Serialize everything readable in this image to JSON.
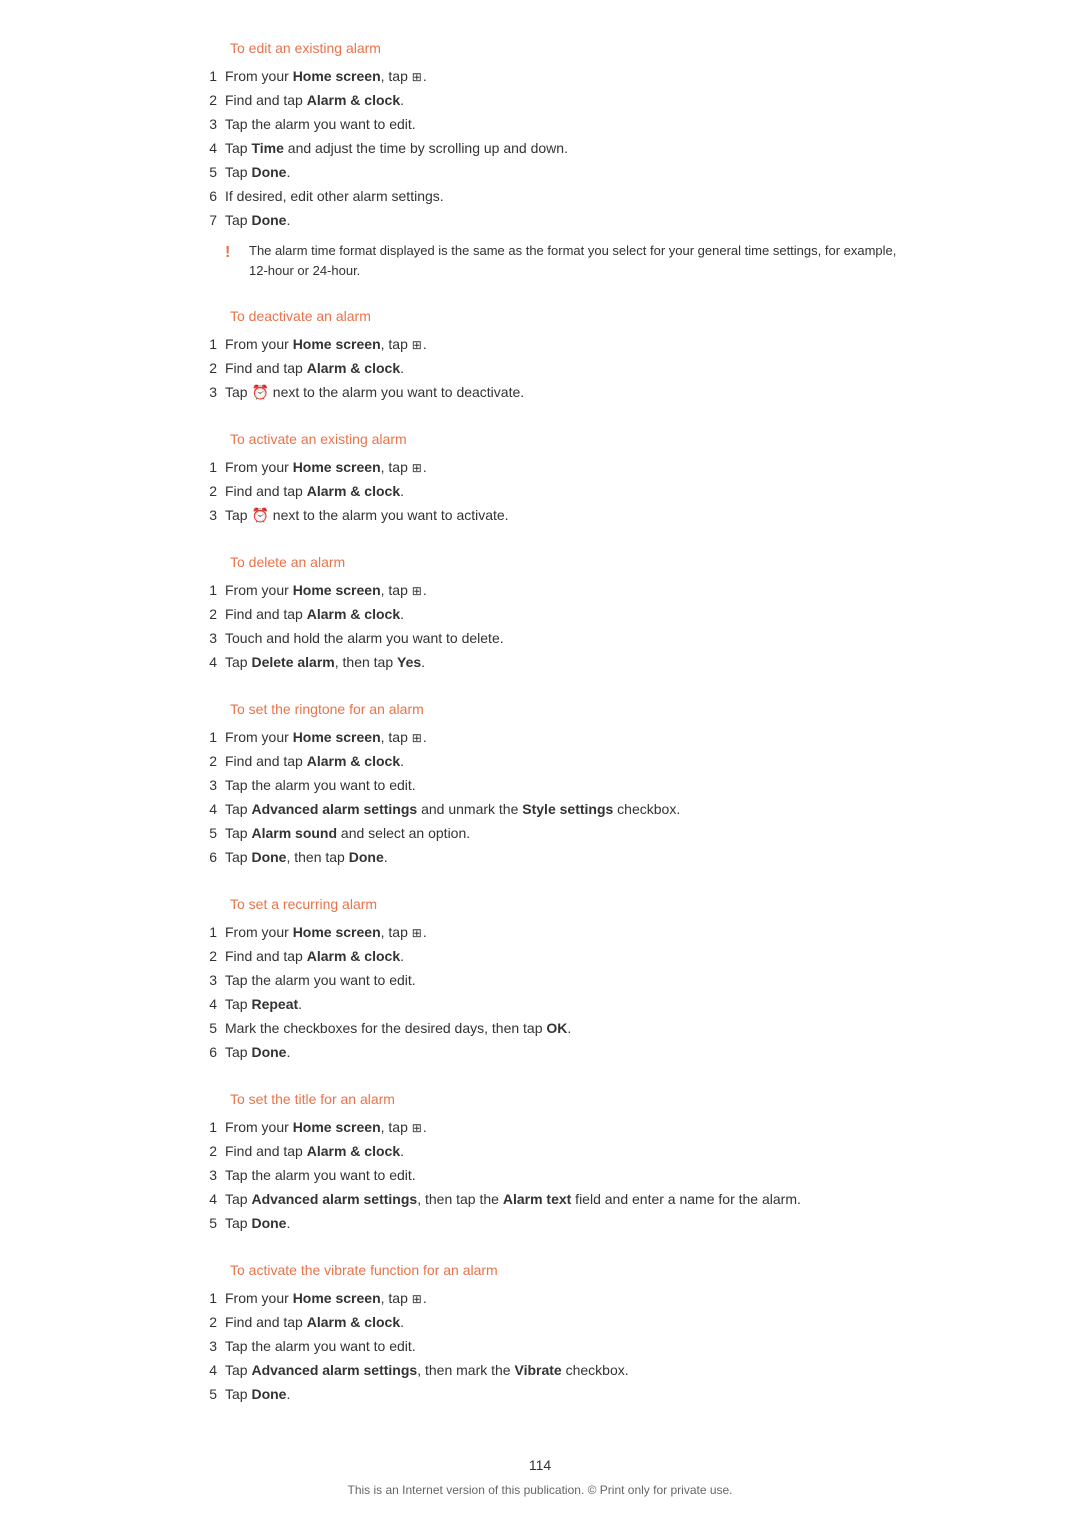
{
  "sections": [
    {
      "id": "edit-alarm",
      "title": "To edit an existing alarm",
      "steps": [
        {
          "num": "1",
          "text": "From your <b>Home screen</b>, tap <span class=\"menu-icon\">⊞</span>."
        },
        {
          "num": "2",
          "text": "Find and tap <b>Alarm &amp; clock</b>."
        },
        {
          "num": "3",
          "text": "Tap the alarm you want to edit."
        },
        {
          "num": "4",
          "text": "Tap <b>Time</b> and adjust the time by scrolling up and down."
        },
        {
          "num": "5",
          "text": "Tap <b>Done</b>."
        },
        {
          "num": "6",
          "text": "If desired, edit other alarm settings."
        },
        {
          "num": "7",
          "text": "Tap <b>Done</b>."
        }
      ],
      "note": "The alarm time format displayed is the same as the format you select for your general time settings, for example, 12-hour or 24-hour."
    },
    {
      "id": "deactivate-alarm",
      "title": "To deactivate an alarm",
      "steps": [
        {
          "num": "1",
          "text": "From your <b>Home screen</b>, tap <span class=\"menu-icon\">⊞</span>."
        },
        {
          "num": "2",
          "text": "Find and tap <b>Alarm &amp; clock</b>."
        },
        {
          "num": "3",
          "text": "Tap ⏰ next to the alarm you want to deactivate."
        }
      ]
    },
    {
      "id": "activate-alarm",
      "title": "To activate an existing alarm",
      "steps": [
        {
          "num": "1",
          "text": "From your <b>Home screen</b>, tap <span class=\"menu-icon\">⊞</span>."
        },
        {
          "num": "2",
          "text": "Find and tap <b>Alarm &amp; clock</b>."
        },
        {
          "num": "3",
          "text": "Tap ⏰ next to the alarm you want to activate."
        }
      ]
    },
    {
      "id": "delete-alarm",
      "title": "To delete an alarm",
      "steps": [
        {
          "num": "1",
          "text": "From your <b>Home screen</b>, tap <span class=\"menu-icon\">⊞</span>."
        },
        {
          "num": "2",
          "text": "Find and tap <b>Alarm &amp; clock</b>."
        },
        {
          "num": "3",
          "text": "Touch and hold the alarm you want to delete."
        },
        {
          "num": "4",
          "text": "Tap <b>Delete alarm</b>, then tap <b>Yes</b>."
        }
      ]
    },
    {
      "id": "set-ringtone",
      "title": "To set the ringtone for an alarm",
      "steps": [
        {
          "num": "1",
          "text": "From your <b>Home screen</b>, tap <span class=\"menu-icon\">⊞</span>."
        },
        {
          "num": "2",
          "text": "Find and tap <b>Alarm &amp; clock</b>."
        },
        {
          "num": "3",
          "text": "Tap the alarm you want to edit."
        },
        {
          "num": "4",
          "text": "Tap <b>Advanced alarm settings</b> and unmark the <b>Style settings</b> checkbox."
        },
        {
          "num": "5",
          "text": "Tap <b>Alarm sound</b> and select an option."
        },
        {
          "num": "6",
          "text": "Tap <b>Done</b>, then tap <b>Done</b>."
        }
      ]
    },
    {
      "id": "recurring-alarm",
      "title": "To set a recurring alarm",
      "steps": [
        {
          "num": "1",
          "text": "From your <b>Home screen</b>, tap <span class=\"menu-icon\">⊞</span>."
        },
        {
          "num": "2",
          "text": "Find and tap <b>Alarm &amp; clock</b>."
        },
        {
          "num": "3",
          "text": "Tap the alarm you want to edit."
        },
        {
          "num": "4",
          "text": "Tap <b>Repeat</b>."
        },
        {
          "num": "5",
          "text": "Mark the checkboxes for the desired days, then tap <b>OK</b>."
        },
        {
          "num": "6",
          "text": "Tap <b>Done</b>."
        }
      ]
    },
    {
      "id": "set-title",
      "title": "To set the title for an alarm",
      "steps": [
        {
          "num": "1",
          "text": "From your <b>Home screen</b>, tap <span class=\"menu-icon\">⊞</span>."
        },
        {
          "num": "2",
          "text": "Find and tap <b>Alarm &amp; clock</b>."
        },
        {
          "num": "3",
          "text": "Tap the alarm you want to edit."
        },
        {
          "num": "4",
          "text": "Tap <b>Advanced alarm settings</b>, then tap the <b>Alarm text</b> field and enter a name for the alarm."
        },
        {
          "num": "5",
          "text": "Tap <b>Done</b>."
        }
      ]
    },
    {
      "id": "vibrate-alarm",
      "title": "To activate the vibrate function for an alarm",
      "steps": [
        {
          "num": "1",
          "text": "From your <b>Home screen</b>, tap <span class=\"menu-icon\">⊞</span>."
        },
        {
          "num": "2",
          "text": "Find and tap <b>Alarm &amp; clock</b>."
        },
        {
          "num": "3",
          "text": "Tap the alarm you want to edit."
        },
        {
          "num": "4",
          "text": "Tap <b>Advanced alarm settings</b>, then mark the <b>Vibrate</b> checkbox."
        },
        {
          "num": "5",
          "text": "Tap <b>Done</b>."
        }
      ]
    }
  ],
  "footer": {
    "page_number": "114",
    "footer_text": "This is an Internet version of this publication. © Print only for private use."
  }
}
